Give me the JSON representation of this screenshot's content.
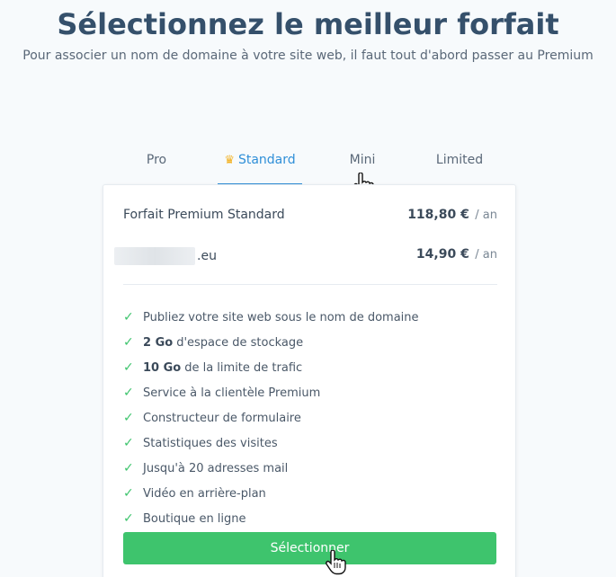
{
  "header": {
    "title": "Sélectionnez le meilleur forfait",
    "subtitle": "Pour associer un nom de domaine à votre site web, il faut tout d'abord passer au Premium"
  },
  "tabs": [
    {
      "label": "Pro"
    },
    {
      "label": "Standard",
      "icon": "crown-icon",
      "active": true
    },
    {
      "label": "Mini"
    },
    {
      "label": "Limited"
    }
  ],
  "plan": {
    "name": "Forfait Premium Standard",
    "price": "118,80 €",
    "period": "/ an"
  },
  "domain": {
    "suffix": ".eu",
    "price": "14,90 €",
    "period": "/ an"
  },
  "features": [
    {
      "strong": "",
      "text": "Publiez votre site web sous le nom de domaine"
    },
    {
      "strong": "2 Go",
      "text": "d'espace de stockage"
    },
    {
      "strong": "10 Go",
      "text": "de la limite de trafic"
    },
    {
      "strong": "",
      "text": "Service à la clientèle Premium"
    },
    {
      "strong": "",
      "text": "Constructeur de formulaire"
    },
    {
      "strong": "",
      "text": "Statistiques des visites"
    },
    {
      "strong": "",
      "text": "Jusqu'à 20 adresses mail"
    },
    {
      "strong": "",
      "text": "Vidéo en arrière-plan"
    },
    {
      "strong": "",
      "text": "Boutique en ligne"
    }
  ],
  "button": {
    "label": "Sélectionner"
  },
  "colors": {
    "accent": "#2f8fd8",
    "success": "#3ec46d",
    "title": "#35506b",
    "crown": "#f2b01e"
  }
}
